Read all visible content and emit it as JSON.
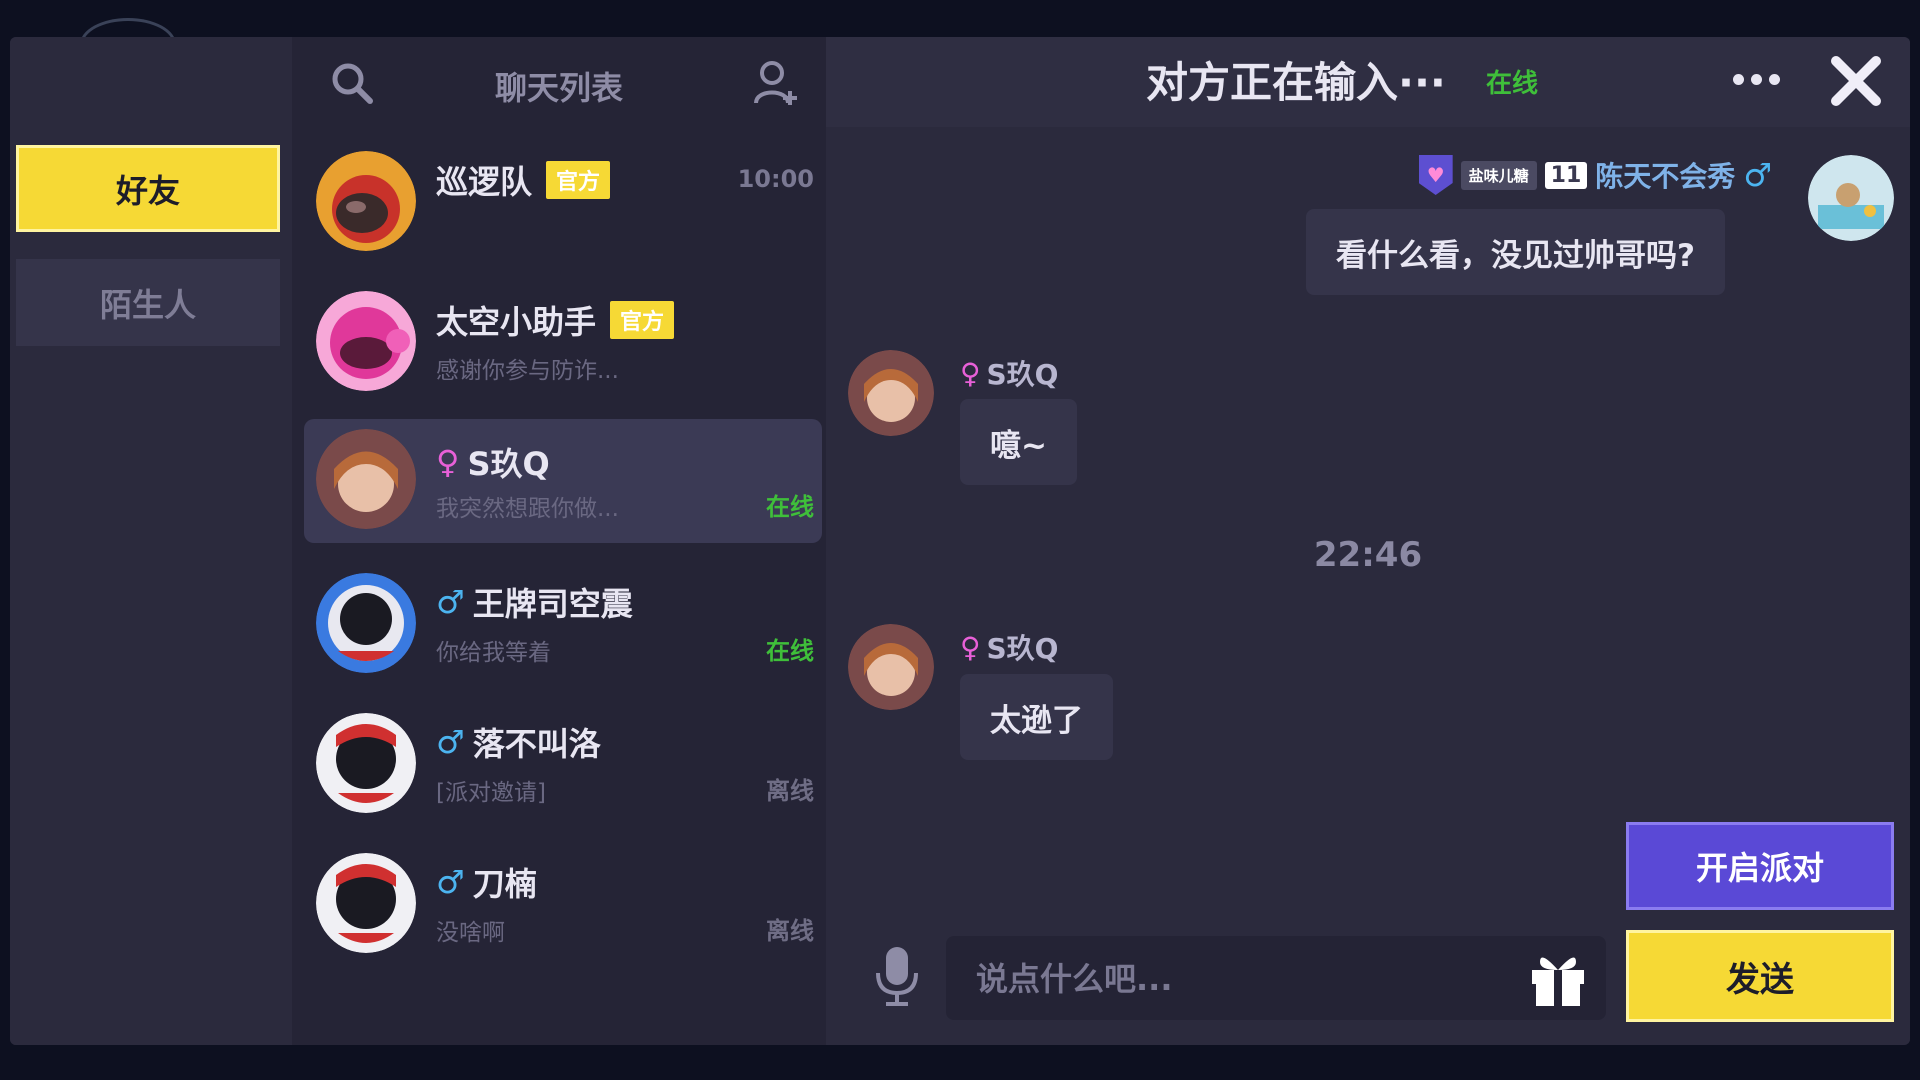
{
  "tabs": [
    {
      "label": "好友",
      "active": true
    },
    {
      "label": "陌生人",
      "active": false
    }
  ],
  "list": {
    "title": "聊天列表",
    "items": [
      {
        "name": "巡逻队",
        "badge": "官方",
        "preview": "",
        "meta": "10:00",
        "meta_kind": "time",
        "gender": ""
      },
      {
        "name": "太空小助手",
        "badge": "官方",
        "preview": "感谢你参与防诈...",
        "meta": "",
        "meta_kind": "",
        "gender": ""
      },
      {
        "name": "S玖Q",
        "badge": "",
        "preview": "我突然想跟你做...",
        "meta": "在线",
        "meta_kind": "online",
        "gender": "female",
        "selected": true
      },
      {
        "name": "王牌司空震",
        "badge": "",
        "preview": "你给我等着",
        "meta": "在线",
        "meta_kind": "online",
        "gender": "male"
      },
      {
        "name": "落不叫洛",
        "badge": "",
        "preview": "[派对邀请]",
        "meta": "离线",
        "meta_kind": "offline",
        "gender": "male"
      },
      {
        "name": "刀楠",
        "badge": "",
        "preview": "没啥啊",
        "meta": "离线",
        "meta_kind": "offline",
        "gender": "male"
      }
    ]
  },
  "chat": {
    "title": "对方正在输入···",
    "status": "在线",
    "me": {
      "tag_label": "盐味儿糖",
      "tag_level": "11",
      "name": "陈天不会秀",
      "gender_symbol": "♂"
    },
    "messages": [
      {
        "from": "me",
        "text": "看什么看，没见过帅哥吗?"
      },
      {
        "from": "other",
        "sender": "S玖Q",
        "text": "噫~"
      },
      {
        "from": "time",
        "text": "22:46"
      },
      {
        "from": "other",
        "sender": "S玖Q",
        "text": "太逊了"
      }
    ],
    "input_placeholder": "说点什么吧...",
    "party_label": "开启派对",
    "send_label": "发送"
  },
  "icons": {
    "male": "♂",
    "female": "♀"
  },
  "colors": {
    "accent_yellow": "#f6d935",
    "accent_purple": "#5a49d6",
    "online_green": "#3fbf3a",
    "male_blue": "#4cb4f0",
    "female_pink": "#e860d8"
  }
}
